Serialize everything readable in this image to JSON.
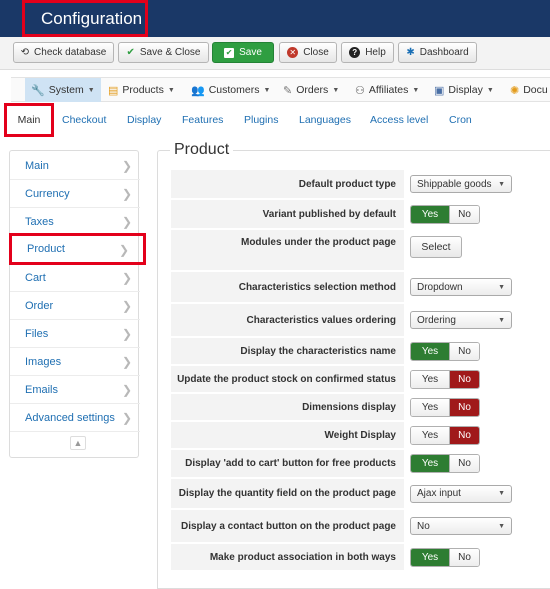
{
  "header": {
    "title": "Configuration"
  },
  "toolbar": {
    "check_database": "Check database",
    "save_close": "Save & Close",
    "save": "Save",
    "close": "Close",
    "help": "Help",
    "dashboard": "Dashboard"
  },
  "menu": {
    "system": "System",
    "products": "Products",
    "customers": "Customers",
    "orders": "Orders",
    "affiliates": "Affiliates",
    "display": "Display",
    "docu": "Docu"
  },
  "tabs": {
    "main": "Main",
    "checkout": "Checkout",
    "display": "Display",
    "features": "Features",
    "plugins": "Plugins",
    "languages": "Languages",
    "access_level": "Access level",
    "cron": "Cron"
  },
  "sidebar": {
    "items": [
      "Main",
      "Currency",
      "Taxes",
      "Product",
      "Cart",
      "Order",
      "Files",
      "Images",
      "Emails",
      "Advanced settings"
    ],
    "selected": "Product"
  },
  "panel": {
    "legend": "Product",
    "yes": "Yes",
    "no": "No",
    "rows": {
      "default_product_type": {
        "label": "Default product type",
        "value": "Shippable goods"
      },
      "variant_published": {
        "label": "Variant published by default",
        "value": "Yes"
      },
      "modules_under_product": {
        "label": "Modules under the product page",
        "button": "Select"
      },
      "char_selection_method": {
        "label": "Characteristics selection method",
        "value": "Dropdown"
      },
      "char_values_ordering": {
        "label": "Characteristics values ordering",
        "value": "Ordering"
      },
      "display_char_name": {
        "label": "Display the characteristics name",
        "value": "Yes"
      },
      "update_stock": {
        "label": "Update the product stock on confirmed status",
        "value": "No"
      },
      "dimensions_display": {
        "label": "Dimensions display",
        "value": "No"
      },
      "weight_display": {
        "label": "Weight Display",
        "value": "No"
      },
      "add_to_cart_free": {
        "label": "Display 'add to cart' button for free products",
        "value": "Yes"
      },
      "quantity_field": {
        "label": "Display the quantity field on the product page",
        "value": "Ajax input"
      },
      "contact_button": {
        "label": "Display a contact button on the product page",
        "value": "No"
      },
      "association_both_ways": {
        "label": "Make product association in both ways",
        "value": "Yes"
      }
    }
  },
  "colors": {
    "header_bg": "#1a3867",
    "highlight": "#e3001b",
    "yes_active": "#2e7d32",
    "no_active": "#a0191a",
    "link": "#1f6fb2"
  }
}
